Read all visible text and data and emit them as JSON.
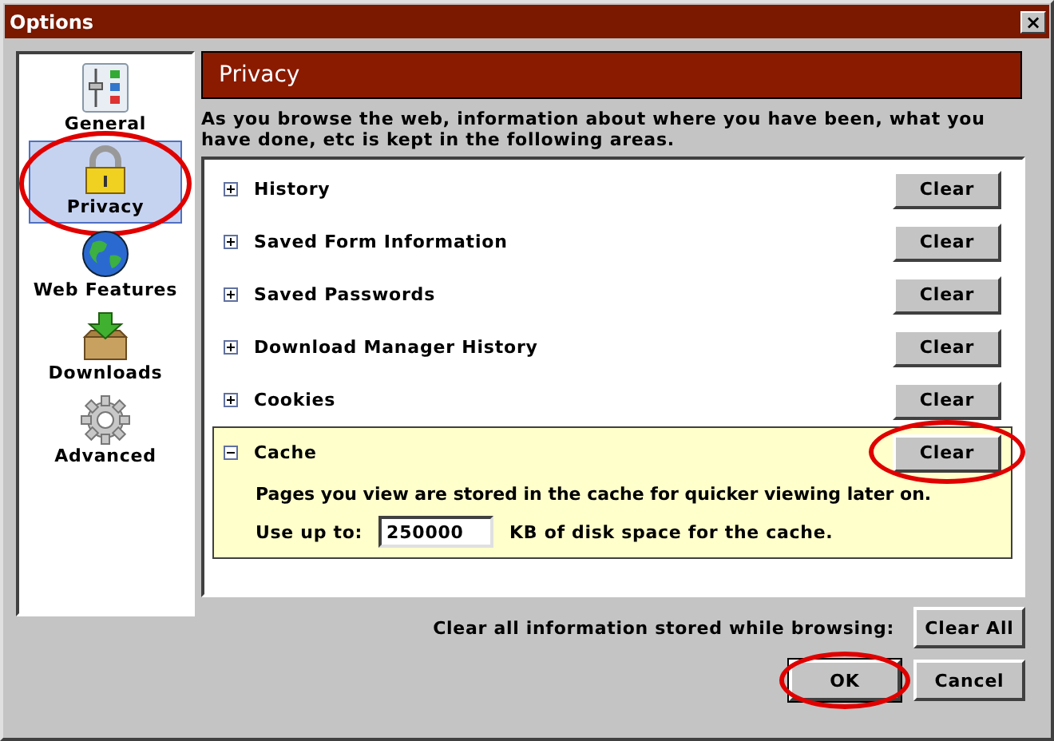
{
  "window": {
    "title": "Options",
    "close": "×"
  },
  "sidebar": {
    "items": [
      {
        "label": "General",
        "selected": false,
        "circled": false
      },
      {
        "label": "Privacy",
        "selected": true,
        "circled": true
      },
      {
        "label": "Web Features",
        "selected": false,
        "circled": false
      },
      {
        "label": "Downloads",
        "selected": false,
        "circled": false
      },
      {
        "label": "Advanced",
        "selected": false,
        "circled": false
      }
    ]
  },
  "panel": {
    "title": "Privacy",
    "description": "As you browse the web, information about where you have been, what you have done, etc is kept in the following areas.",
    "sections": [
      {
        "label": "History",
        "expanded": false,
        "button": "Clear"
      },
      {
        "label": "Saved Form Information",
        "expanded": false,
        "button": "Clear"
      },
      {
        "label": "Saved Passwords",
        "expanded": false,
        "button": "Clear"
      },
      {
        "label": "Download Manager History",
        "expanded": false,
        "button": "Clear"
      },
      {
        "label": "Cookies",
        "expanded": false,
        "button": "Clear"
      },
      {
        "label": "Cache",
        "expanded": true,
        "button": "Clear",
        "circled": true,
        "detail": "Pages you view are stored in the cache for quicker viewing later on.",
        "field_label": "Use up to:",
        "field_value": "250000",
        "field_suffix": "KB of disk space for the cache."
      }
    ]
  },
  "clear_all": {
    "label": "Clear all information stored while browsing:",
    "button": "Clear All"
  },
  "buttons": [
    {
      "label": "OK",
      "circled": true
    },
    {
      "label": "Cancel",
      "circled": false
    }
  ]
}
